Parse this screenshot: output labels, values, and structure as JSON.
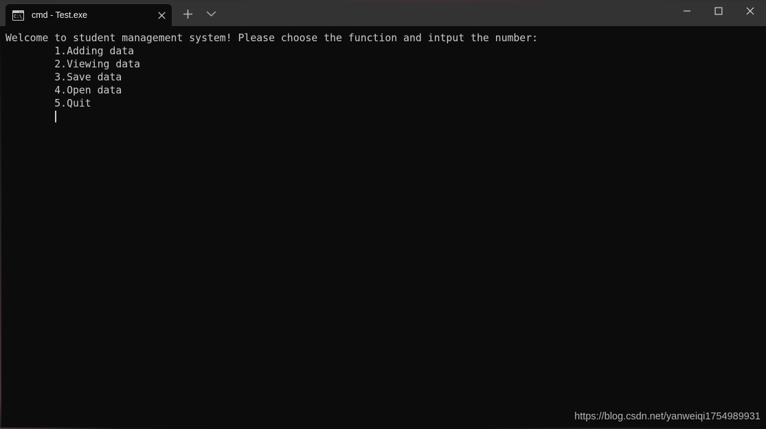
{
  "titlebar": {
    "tab": {
      "icon": "cmd-console-icon",
      "icon_text": "C:\\_",
      "title": "cmd - Test.exe",
      "close_label": "×"
    },
    "new_tab_label": "+",
    "dropdown_label": "v",
    "window_controls": {
      "minimize_label": "—",
      "maximize_label": "□",
      "close_label": "×"
    }
  },
  "terminal": {
    "lines": [
      "Welcome to student management system! Please choose the function and intput the number:",
      "        1.Adding data",
      "        2.Viewing data",
      "        3.Save data",
      "        4.Open data",
      "        5.Quit"
    ],
    "cursor_visible": true,
    "background_color": "#0c0c0c",
    "foreground_color": "#cccccc"
  },
  "watermark": {
    "text": "https://blog.csdn.net/yanweiqi1754989931"
  }
}
